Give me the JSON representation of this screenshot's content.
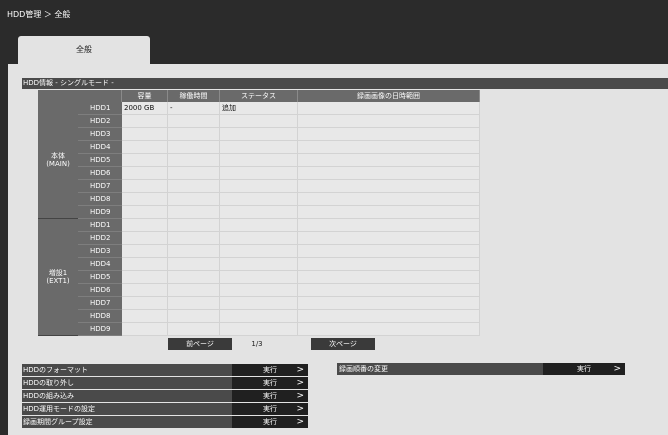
{
  "breadcrumb": "HDD管理 ＞ 全般",
  "tab": "全般",
  "section_title": "HDD情報 - シングルモード -",
  "columns": [
    "容量",
    "稼働時間",
    "ステータス",
    "録画画像の日時範囲"
  ],
  "groups": [
    {
      "label_line1": "本体",
      "label_line2": "(MAIN)",
      "rows": [
        {
          "name": "HDD1",
          "capacity": "2000 GB",
          "uptime": "-",
          "status": "追加",
          "range": ""
        },
        {
          "name": "HDD2",
          "capacity": "",
          "uptime": "",
          "status": "",
          "range": ""
        },
        {
          "name": "HDD3",
          "capacity": "",
          "uptime": "",
          "status": "",
          "range": ""
        },
        {
          "name": "HDD4",
          "capacity": "",
          "uptime": "",
          "status": "",
          "range": ""
        },
        {
          "name": "HDD5",
          "capacity": "",
          "uptime": "",
          "status": "",
          "range": ""
        },
        {
          "name": "HDD6",
          "capacity": "",
          "uptime": "",
          "status": "",
          "range": ""
        },
        {
          "name": "HDD7",
          "capacity": "",
          "uptime": "",
          "status": "",
          "range": ""
        },
        {
          "name": "HDD8",
          "capacity": "",
          "uptime": "",
          "status": "",
          "range": ""
        },
        {
          "name": "HDD9",
          "capacity": "",
          "uptime": "",
          "status": "",
          "range": ""
        }
      ]
    },
    {
      "label_line1": "増設1",
      "label_line2": "(EXT1)",
      "rows": [
        {
          "name": "HDD1",
          "capacity": "",
          "uptime": "",
          "status": "",
          "range": ""
        },
        {
          "name": "HDD2",
          "capacity": "",
          "uptime": "",
          "status": "",
          "range": ""
        },
        {
          "name": "HDD3",
          "capacity": "",
          "uptime": "",
          "status": "",
          "range": ""
        },
        {
          "name": "HDD4",
          "capacity": "",
          "uptime": "",
          "status": "",
          "range": ""
        },
        {
          "name": "HDD5",
          "capacity": "",
          "uptime": "",
          "status": "",
          "range": ""
        },
        {
          "name": "HDD6",
          "capacity": "",
          "uptime": "",
          "status": "",
          "range": ""
        },
        {
          "name": "HDD7",
          "capacity": "",
          "uptime": "",
          "status": "",
          "range": ""
        },
        {
          "name": "HDD8",
          "capacity": "",
          "uptime": "",
          "status": "",
          "range": ""
        },
        {
          "name": "HDD9",
          "capacity": "",
          "uptime": "",
          "status": "",
          "range": ""
        }
      ]
    }
  ],
  "pager": {
    "prev": "前ページ",
    "page": "1/3",
    "next": "次ページ"
  },
  "actions": [
    {
      "label": "HDDのフォーマット",
      "button": "実行"
    },
    {
      "label": "HDDの取り外し",
      "button": "実行"
    },
    {
      "label": "HDDの組み込み",
      "button": "実行"
    },
    {
      "label": "HDD運用モードの設定",
      "button": "実行"
    },
    {
      "label": "録画期間グループ設定",
      "button": "実行"
    }
  ],
  "record_order": {
    "label": "録画順番の変更",
    "button": "実行"
  },
  "chevron": ">"
}
